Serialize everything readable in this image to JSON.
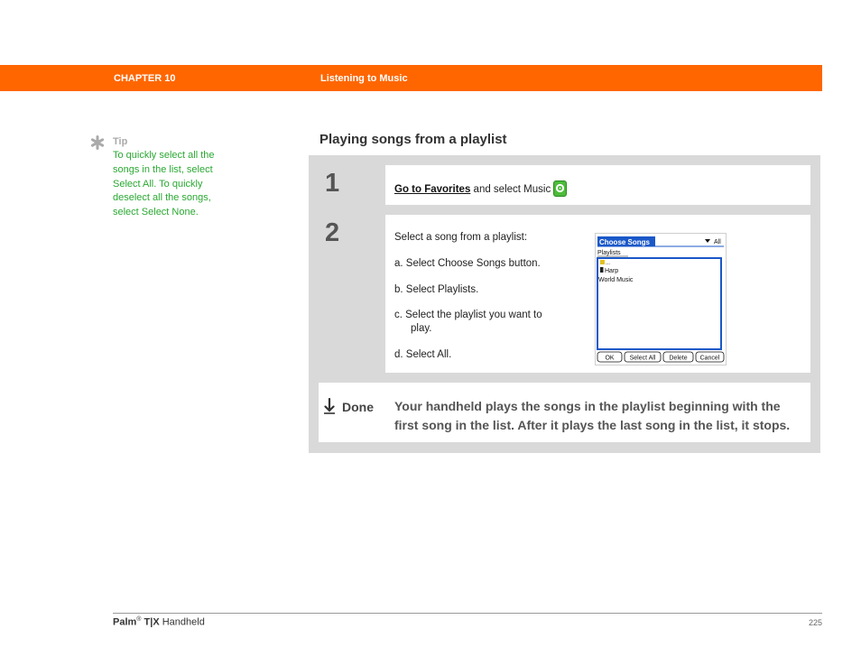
{
  "header": {
    "chapter": "CHAPTER 10",
    "title": "Listening to Music"
  },
  "tip": {
    "label": "Tip",
    "text": "To quickly select all the songs in the list, select Select All. To quickly deselect all the songs, select Select None."
  },
  "section_title": "Playing songs from a playlist",
  "step1": {
    "number": "1",
    "link": "Go to Favorites",
    "text": " and select Music"
  },
  "step2": {
    "number": "2",
    "intro": "Select a song from a playlist:",
    "a": "a.  Select Choose Songs button.",
    "b": "b.  Select Playlists.",
    "c1": "c.  Select the playlist you want to",
    "c2": "play.",
    "d": "d.  Select All."
  },
  "screen": {
    "title": "Choose Songs",
    "filter": "All",
    "list_header": "Playlists",
    "items": [
      "...",
      "Harp",
      "World Music"
    ],
    "buttons": [
      "OK",
      "Select All",
      "Delete",
      "Cancel"
    ]
  },
  "done": {
    "label": "Done",
    "line1": "Your handheld plays the songs in the playlist beginning with the",
    "line2": "first song in the list. After it plays the last song in the list, it stops."
  },
  "footer": {
    "brand": "Palm",
    "reg": "®",
    "model": "T|X",
    "product": "Handheld",
    "page": "225"
  },
  "colors": {
    "accent": "#ff6600",
    "tip_green": "#2aa832",
    "panel_gray": "#d9d9d9",
    "palm_blue": "#1a58c8"
  }
}
